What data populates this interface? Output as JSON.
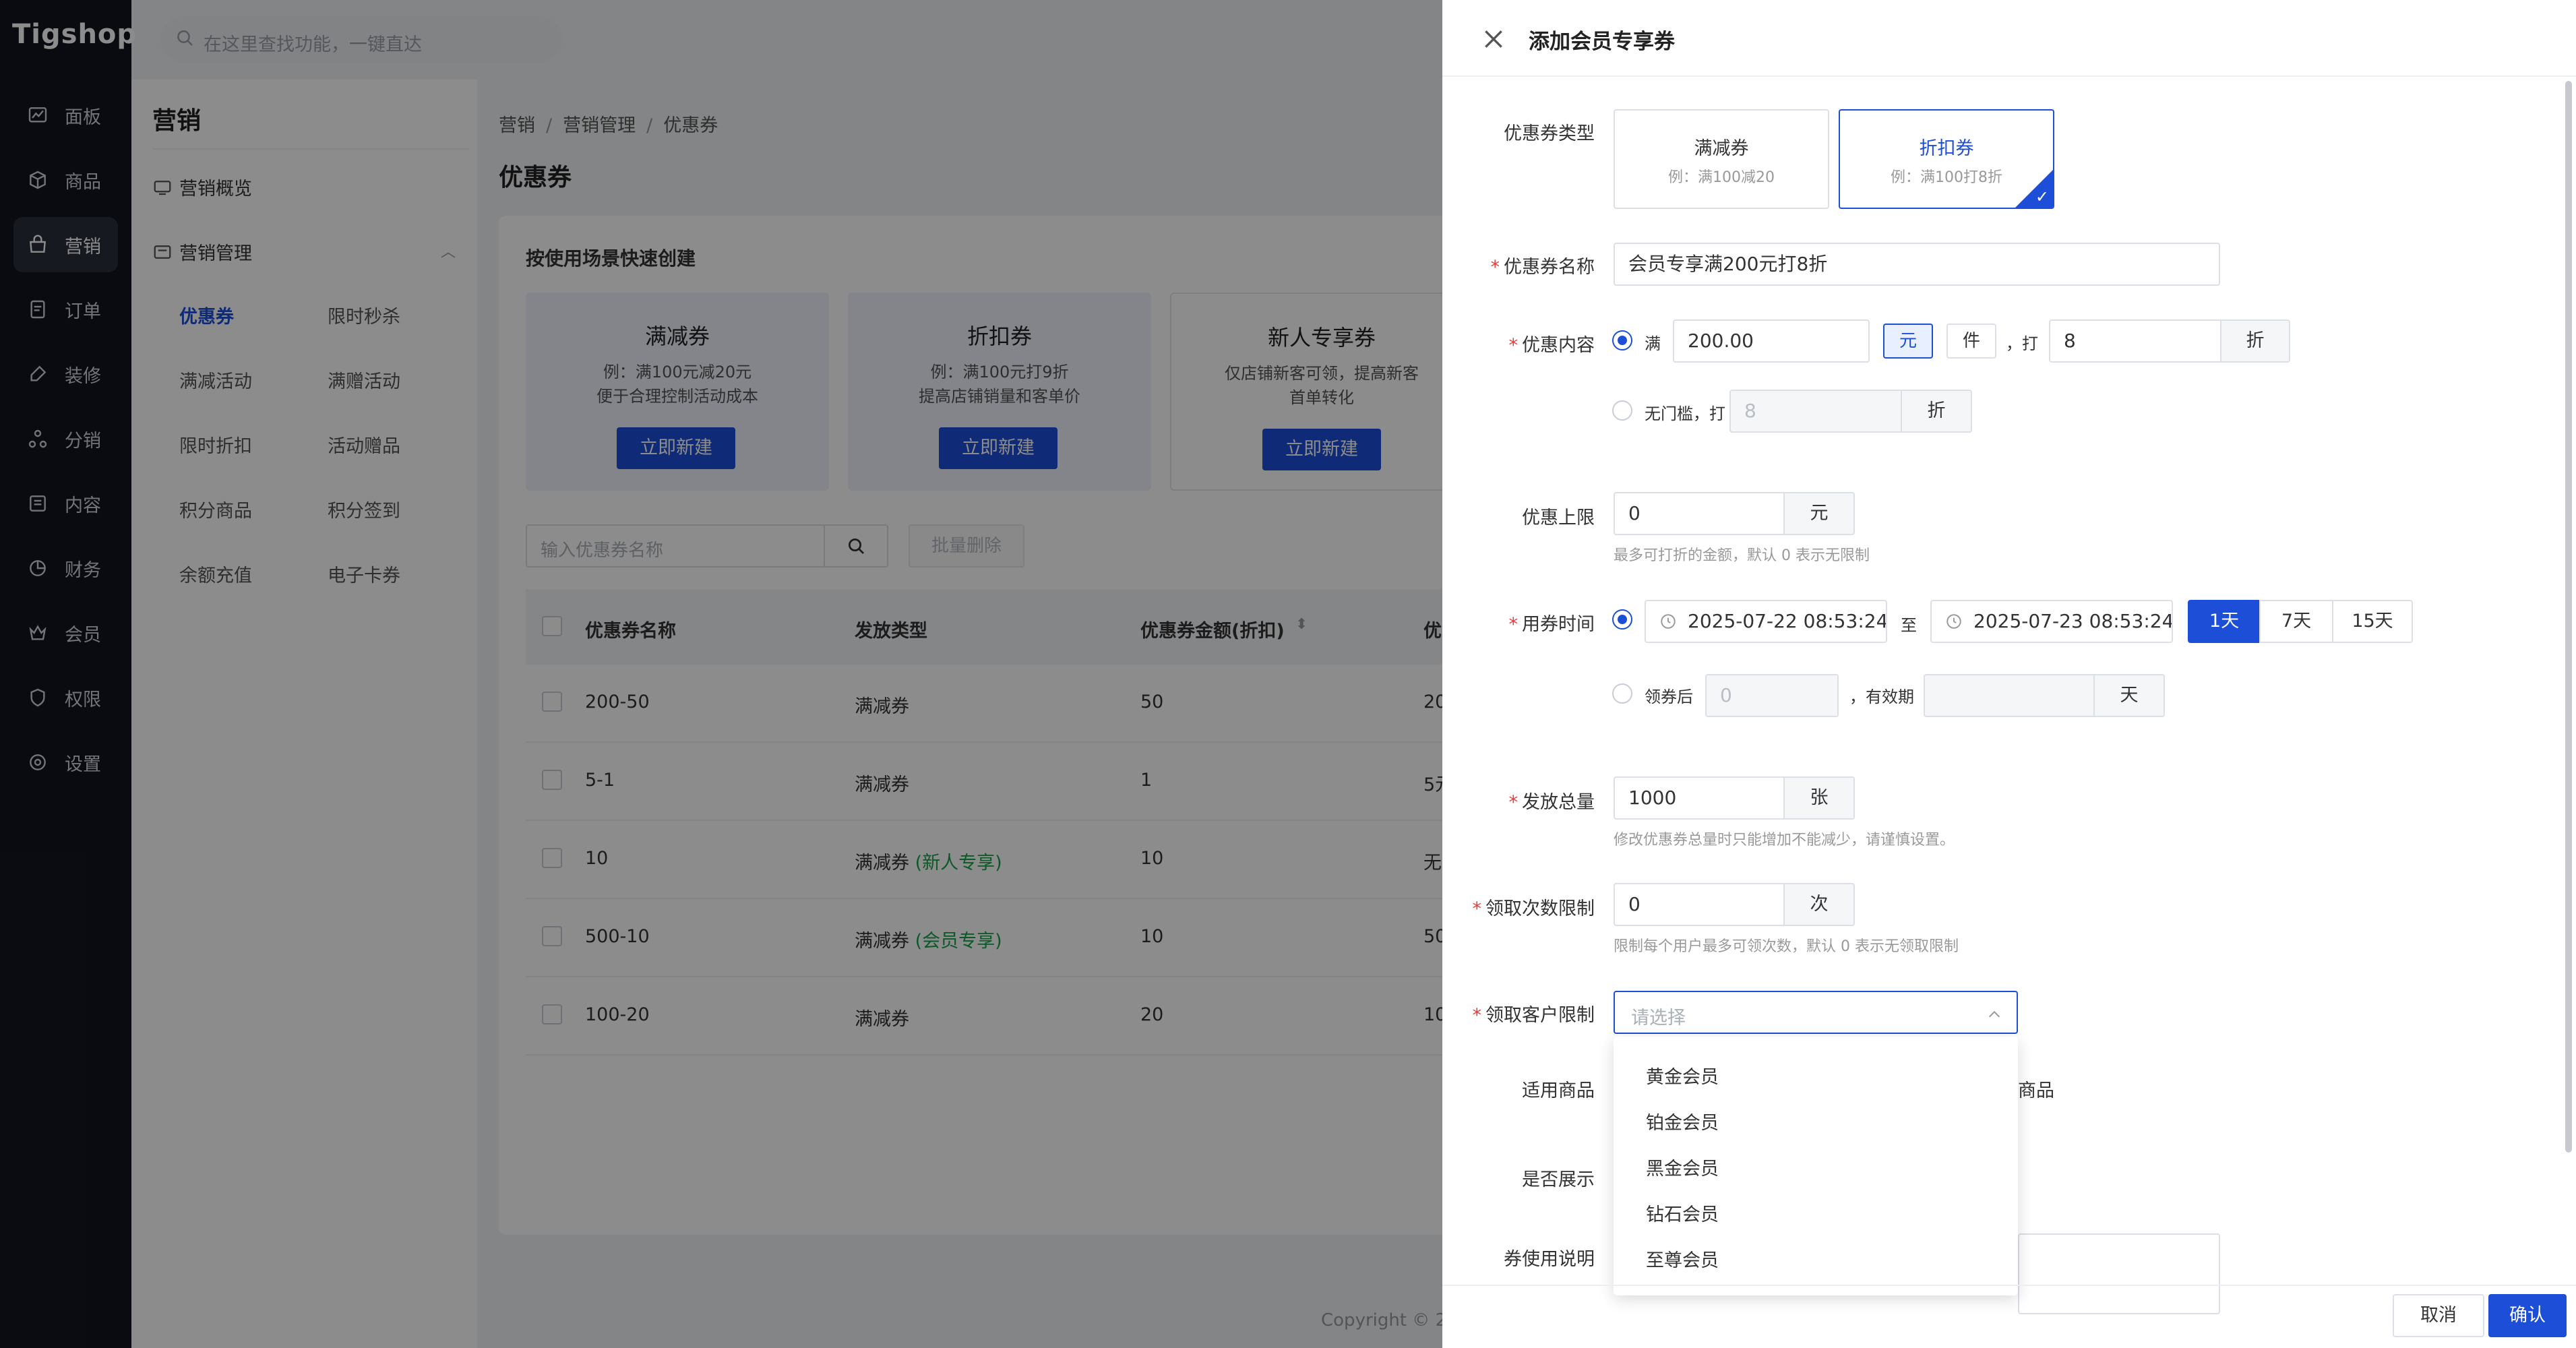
{
  "app": {
    "logo": "Tigshop",
    "search_placeholder": "在这里查找功能，一键直达"
  },
  "nav": [
    {
      "label": "面板",
      "icon": "chart-icon"
    },
    {
      "label": "商品",
      "icon": "box-icon"
    },
    {
      "label": "营销",
      "icon": "marketing-icon",
      "active": true
    },
    {
      "label": "订单",
      "icon": "order-icon"
    },
    {
      "label": "装修",
      "icon": "brush-icon"
    },
    {
      "label": "分销",
      "icon": "distribution-icon"
    },
    {
      "label": "内容",
      "icon": "content-icon"
    },
    {
      "label": "财务",
      "icon": "finance-icon"
    },
    {
      "label": "会员",
      "icon": "member-icon"
    },
    {
      "label": "权限",
      "icon": "shield-icon"
    },
    {
      "label": "设置",
      "icon": "gear-icon"
    }
  ],
  "sub": {
    "title": "营销",
    "overview": "营销概览",
    "manage": "营销管理",
    "links": [
      "优惠券",
      "限时秒杀",
      "满减活动",
      "满赠活动",
      "限时折扣",
      "活动赠品",
      "积分商品",
      "积分签到",
      "余额充值",
      "电子卡券"
    ]
  },
  "breadcrumb": [
    "营销",
    "营销管理",
    "优惠券"
  ],
  "page_title": "优惠券",
  "quick": {
    "title": "按使用场景快速创建",
    "cards": [
      {
        "title": "满减券",
        "d1": "例：满100元减20元",
        "d2": "便于合理控制活动成本",
        "btn": "立即新建"
      },
      {
        "title": "折扣券",
        "d1": "例：满100元打9折",
        "d2": "提高店铺销量和客单价",
        "btn": "立即新建"
      },
      {
        "title": "新人专享券",
        "d1": "仅店铺新客可领，提高新客",
        "d2": "首单转化",
        "btn": "立即新建"
      }
    ]
  },
  "list": {
    "search_placeholder": "输入优惠券名称",
    "batch_delete": "批量删除",
    "headers": [
      "优惠券名称",
      "发放类型",
      "优惠券金额(折扣)",
      "优"
    ],
    "rows": [
      {
        "name": "200-50",
        "type": "满减券",
        "tag": "",
        "amount": "50",
        "extra": "20"
      },
      {
        "name": "5-1",
        "type": "满减券",
        "tag": "",
        "amount": "1",
        "extra": "5元"
      },
      {
        "name": "10",
        "type": "满减券",
        "tag": "(新人专享)",
        "amount": "10",
        "extra": "无"
      },
      {
        "name": "500-10",
        "type": "满减券",
        "tag": "(会员专享)",
        "amount": "10",
        "extra": "50"
      },
      {
        "name": "100-20",
        "type": "满减券",
        "tag": "",
        "amount": "20",
        "extra": "10"
      }
    ]
  },
  "copyright": "Copyright © 2",
  "drawer": {
    "title": "添加会员专享券",
    "coupon_type": {
      "label": "优惠券类型",
      "options": [
        {
          "title": "满减券",
          "sub": "例：满100减20"
        },
        {
          "title": "折扣券",
          "sub": "例：满100打8折",
          "selected": true
        }
      ]
    },
    "name": {
      "label": "优惠券名称",
      "value": "会员专享满200元打8折"
    },
    "content": {
      "label": "优惠内容",
      "full_prefix": "满",
      "full_value": "200.00",
      "unit_yuan": "元",
      "unit_piece": "件",
      "discount_prefix": "，打",
      "discount_value": "8",
      "discount_unit": "折",
      "no_threshold_label": "无门槛，打",
      "no_threshold_value": "8",
      "no_threshold_unit": "折"
    },
    "cap": {
      "label": "优惠上限",
      "value": "0",
      "unit": "元",
      "hint": "最多可打折的金额，默认 0 表示无限制"
    },
    "time": {
      "label": "用券时间",
      "start": "2025-07-22 08:53:24",
      "to": "至",
      "end": "2025-07-23 08:53:24",
      "quick": [
        "1天",
        "7天",
        "15天"
      ],
      "after_label": "领券后",
      "after_value": "0",
      "valid_label": "，有效期",
      "valid_unit": "天"
    },
    "total": {
      "label": "发放总量",
      "value": "1000",
      "unit": "张",
      "hint": "修改优惠券总量时只能增加不能减少，请谨慎设置。"
    },
    "limit": {
      "label": "领取次数限制",
      "value": "0",
      "unit": "次",
      "hint": "限制每个用户最多可领次数，默认 0 表示无领取限制"
    },
    "customer": {
      "label": "领取客户限制",
      "placeholder": "请选择",
      "options": [
        "黄金会员",
        "铂金会员",
        "黑金会员",
        "钻石会员",
        "至尊会员"
      ]
    },
    "goods": {
      "label": "适用商品",
      "trailing": "商品"
    },
    "display": {
      "label": "是否展示"
    },
    "desc": {
      "label": "券使用说明"
    },
    "cancel": "取消",
    "confirm": "确认"
  },
  "colors": {
    "primary": "#1d4ed8",
    "nav_bg": "#121520",
    "required": "#e53e3e",
    "tag_green": "#16a34a"
  }
}
